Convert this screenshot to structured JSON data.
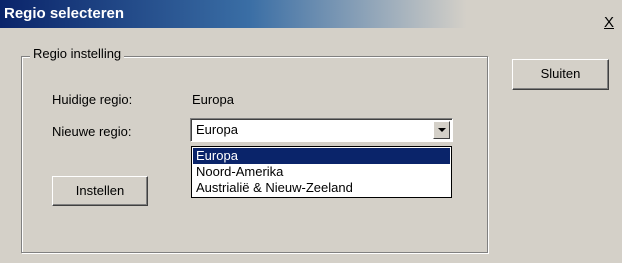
{
  "window": {
    "title": "Regio selecteren",
    "close_label": "X"
  },
  "group": {
    "legend": "Regio instelling",
    "current_label": "Huidige regio:",
    "current_value": "Europa",
    "new_label": "Nieuwe regio:",
    "new_value": "Europa"
  },
  "dropdown": {
    "options": [
      "Europa",
      "Noord-Amerika",
      "Austrialië & Nieuw-Zeeland"
    ],
    "selected_index": 0
  },
  "buttons": {
    "apply_label": "Instellen",
    "close_label": "Sluiten"
  },
  "colors": {
    "title_bar": "#0a246a",
    "selection": "#0a246a",
    "face": "#d4d0c8"
  }
}
